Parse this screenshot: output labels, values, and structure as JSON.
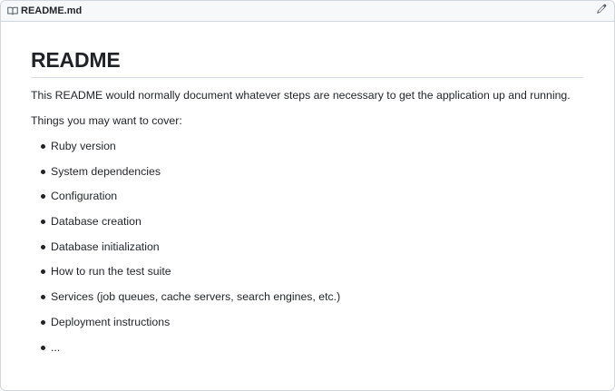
{
  "file_header": {
    "icon": "book-icon",
    "title": "README.md",
    "edit_icon": "pencil-icon"
  },
  "readme": {
    "heading": "README",
    "intro": "This README would normally document whatever steps are necessary to get the application up and running.",
    "cover_intro": "Things you may want to cover:",
    "items": [
      "Ruby version",
      "System dependencies",
      "Configuration",
      "Database creation",
      "Database initialization",
      "How to run the test suite",
      "Services (job queues, cache servers, search engines, etc.)",
      "Deployment instructions",
      "..."
    ]
  },
  "colors": {
    "header_bg": "#f6f8fa",
    "border": "#d0d7de",
    "text": "#1f2328",
    "icon": "#57606a"
  }
}
